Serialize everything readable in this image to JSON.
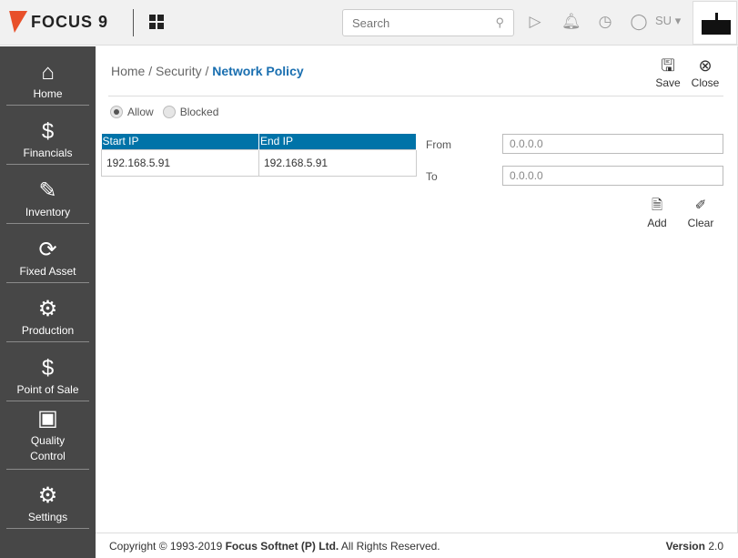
{
  "header": {
    "logo": "FOCUS 9",
    "search_placeholder": "Search",
    "user": "SU"
  },
  "sidebar": {
    "items": [
      {
        "label": "Home",
        "icon": "⌂",
        "name": "home"
      },
      {
        "label": "Financials",
        "icon": "$",
        "name": "financials"
      },
      {
        "label": "Inventory",
        "icon": "✎",
        "name": "inventory"
      },
      {
        "label": "Fixed Asset",
        "icon": "⟳",
        "name": "fixed-asset"
      },
      {
        "label": "Production",
        "icon": "⚙",
        "name": "production"
      },
      {
        "label": "Point of Sale",
        "icon": "$",
        "name": "point-of-sale"
      },
      {
        "label": "Quality Control",
        "icon": "▣",
        "name": "quality-control"
      },
      {
        "label": "Settings",
        "icon": "⚙",
        "name": "settings"
      }
    ]
  },
  "breadcrumb": {
    "home": "Home",
    "sep": "/",
    "security": "Security",
    "current": "Network Policy"
  },
  "actions": {
    "save": "Save",
    "close": "Close",
    "add": "Add",
    "clear": "Clear"
  },
  "mode": {
    "allow": "Allow",
    "blocked": "Blocked",
    "selected": "Allow"
  },
  "table": {
    "headers": [
      "Start IP",
      "End IP"
    ],
    "rows": [
      [
        "192.168.5.91",
        "192.168.5.91"
      ]
    ]
  },
  "form": {
    "from_label": "From",
    "from_value": "0.0.0.0",
    "to_label": "To",
    "to_value": "0.0.0.0"
  },
  "footer": {
    "copyright_pre": "Copyright © 1993-2019 ",
    "company": "Focus Softnet (P) Ltd.",
    "copyright_post": " All Rights Reserved.",
    "version_label": "Version",
    "version": "2.0"
  },
  "colors": {
    "accent": "#0073a8",
    "sidebar": "#474747",
    "link": "#1a6fb0"
  }
}
